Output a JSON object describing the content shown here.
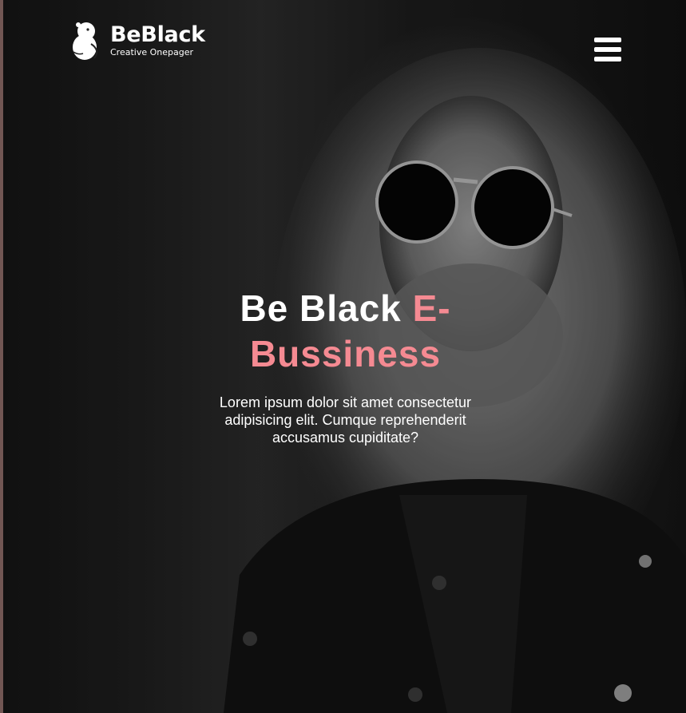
{
  "brand": {
    "name": "BeBlack",
    "tagline": "Creative Onepager"
  },
  "hero": {
    "headline_main": "Be Black",
    "headline_accent": "E-Bussiness",
    "description": "Lorem ipsum dolor sit amet consectetur adipisicing elit. Cumque reprehenderit accusamus cupiditate?"
  },
  "icons": {
    "logo": "beaver-logo-icon",
    "menu": "hamburger-menu-icon"
  },
  "colors": {
    "accent": "#f58a92",
    "text": "#ffffff",
    "background": "#1a1a1a"
  }
}
